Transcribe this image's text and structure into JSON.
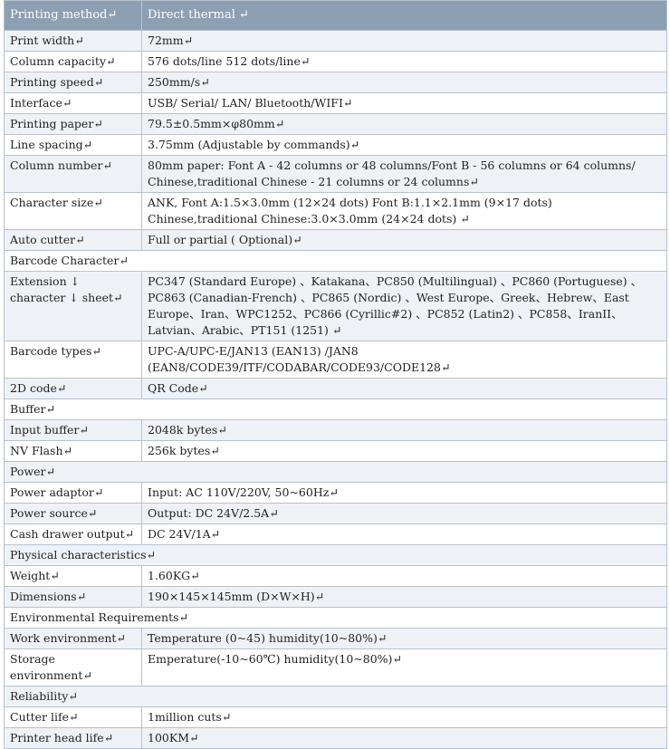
{
  "header": {
    "label": "Printing method↵",
    "value": "Direct thermal ↵"
  },
  "rows": [
    {
      "label": "Print width↵",
      "value": "72mm↵"
    },
    {
      "label": "Column capacity↵",
      "value": "576 dots/line 512 dots/line↵"
    },
    {
      "label": "Printing speed↵",
      "value": "250mm/s↵"
    },
    {
      "label": "Interface↵",
      "value": "USB/ Serial/ LAN/ Bluetooth/WIFI↵"
    },
    {
      "label": "Printing paper↵",
      "value": "79.5±0.5mm×φ80mm↵"
    },
    {
      "label": "Line spacing↵",
      "value": "3.75mm (Adjustable by commands)↵"
    },
    {
      "label": "Column number↵",
      "value": "80mm paper: Font A - 42 columns or 48 columns/Font B - 56 columns or 64 columns/ Chinese,traditional Chinese - 21 columns or 24 columns↵"
    },
    {
      "label": "Character size↵",
      "value": "ANK,  Font A:1.5×3.0mm (12×24 dots)  Font B:1.1×2.1mm (9×17 dots) Chinese,traditional Chinese:3.0×3.0mm (24×24 dots) ↵"
    },
    {
      "label": "Auto cutter↵",
      "value": "Full or partial ( Optional)↵"
    },
    {
      "section": "Barcode Character↵"
    },
    {
      "label": "Extension ↓ character ↓ sheet↵",
      "value": "PC347 (Standard Europe) 、Katakana、PC850 (Multilingual) 、PC860 (Portuguese) 、PC863 (Canadian-French) 、PC865 (Nordic) 、West Europe、Greek、Hebrew、East Europe、Iran、WPC1252、PC866 (Cyrillic#2) 、PC852 (Latin2) 、PC858、IranII、Latvian、Arabic、PT151 (1251) ↵"
    },
    {
      "label": "Barcode types↵",
      "value": "UPC-A/UPC-E/JAN13 (EAN13) /JAN8 (EAN8/CODE39/ITF/CODABAR/CODE93/CODE128↵"
    },
    {
      "label": "2D code↵",
      "value": "QR Code↵"
    },
    {
      "section": "Buffer↵"
    },
    {
      "label": "Input buffer↵",
      "value": "2048k bytes↵"
    },
    {
      "label": "NV Flash↵",
      "value": "256k bytes↵"
    },
    {
      "section": "Power↵"
    },
    {
      "label": "Power adaptor↵",
      "value": "Input: AC 110V/220V, 50~60Hz↵"
    },
    {
      "label": "Power source↵",
      "value": "Output: DC 24V/2.5A↵"
    },
    {
      "label": "Cash drawer output↵",
      "value": "DC 24V/1A↵"
    },
    {
      "section": "Physical characteristics↵"
    },
    {
      "label": "Weight↵",
      "value": "1.60KG↵"
    },
    {
      "label": "Dimensions↵",
      "value": "190×145×145mm (D×W×H)↵"
    },
    {
      "section": "Environmental Requirements↵"
    },
    {
      "label": "Work environment↵",
      "value": "Temperature (0~45) humidity(10~80%)↵"
    },
    {
      "label": "Storage environment↵",
      "value": "Emperature(-10~60℃) humidity(10~80%)↵"
    },
    {
      "section": "Reliability↵"
    },
    {
      "label": "Cutter life↵",
      "value": "1million cuts↵"
    },
    {
      "label": "Printer head life↵",
      "value": "100KM↵"
    }
  ]
}
